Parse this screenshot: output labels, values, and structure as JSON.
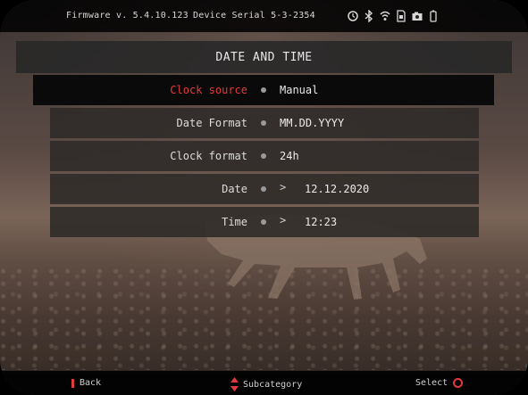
{
  "status_bar": {
    "firmware": "Firmware v. 5.4.10.123",
    "device_serial": "Device Serial 5-3-2354",
    "icons": [
      "timer-icon",
      "bluetooth-icon",
      "wifi-icon",
      "sd-card-icon",
      "camera-icon",
      "battery-icon"
    ]
  },
  "header": {
    "title": "DATE AND TIME"
  },
  "rows": [
    {
      "label": "Clock source",
      "value": "Manual",
      "has_arrow": false,
      "selected": true
    },
    {
      "label": "Date Format",
      "value": "MM.DD.YYYY",
      "has_arrow": false,
      "selected": false
    },
    {
      "label": "Clock format",
      "value": "24h",
      "has_arrow": false,
      "selected": false
    },
    {
      "label": "Date",
      "value": "12.12.2020",
      "has_arrow": true,
      "selected": false
    },
    {
      "label": "Time",
      "value": "12:23",
      "has_arrow": true,
      "selected": false
    }
  ],
  "arrow_glyph": ">",
  "footer": {
    "back_label": "Back",
    "subcategory_label": "Subcategory",
    "select_label": "Select"
  },
  "colors": {
    "accent_red": "#e23b3b",
    "panel": "#2d2a28",
    "selected_row": "#0a0a0a"
  }
}
